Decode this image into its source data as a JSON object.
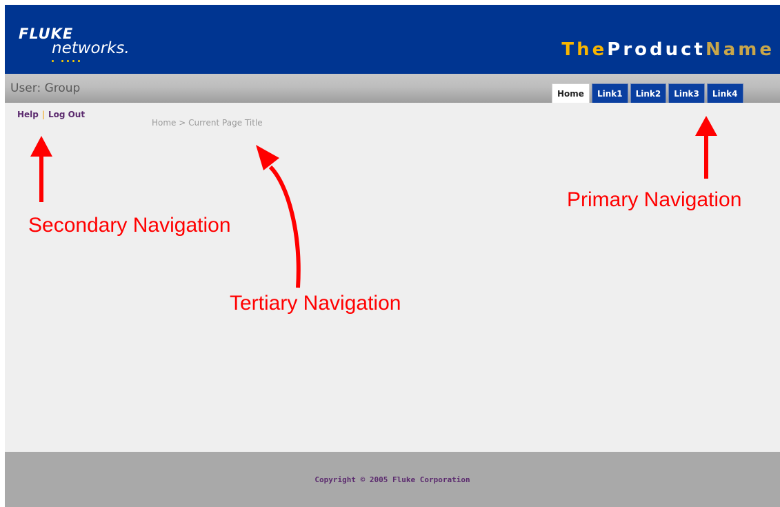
{
  "header": {
    "logo": {
      "brand": "FLUKE",
      "sub": "networks."
    },
    "product_name": {
      "part1": "The",
      "part2": "Product",
      "part3": "Name",
      "colors": {
        "part1": "#f7b500",
        "part2": "#ffffff",
        "part3": "#c9a64a"
      }
    },
    "background_color": "#003591"
  },
  "user_bar": {
    "label": "User: Group"
  },
  "primary_nav": {
    "tabs": [
      {
        "label": "Home",
        "active": true
      },
      {
        "label": "Link1",
        "active": false
      },
      {
        "label": "Link2",
        "active": false
      },
      {
        "label": "Link3",
        "active": false
      },
      {
        "label": "Link4",
        "active": false
      }
    ]
  },
  "secondary_nav": {
    "help": "Help",
    "separator": "|",
    "logout": "Log Out"
  },
  "breadcrumb": {
    "home": "Home",
    "separator": ">",
    "current": "Current Page Title"
  },
  "annotations": {
    "secondary": "Secondary Navigation",
    "primary": "Primary Navigation",
    "tertiary": "Tertiary Navigation",
    "color": "#ff0000"
  },
  "footer": {
    "copyright": "Copyright © 2005 Fluke Corporation"
  }
}
